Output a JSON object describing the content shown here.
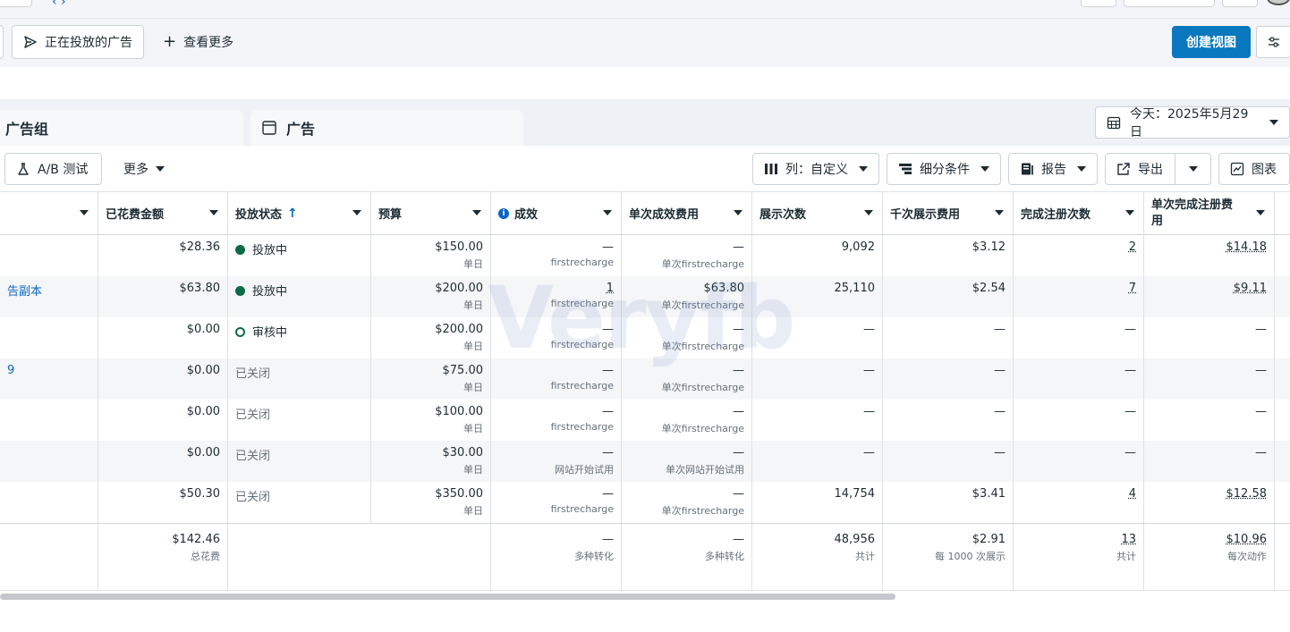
{
  "nav": {
    "running_ads_label": "正在投放的广告",
    "see_more_label": "查看更多",
    "create_view_label": "创建视图"
  },
  "tabs": {
    "adset_label": "广告组",
    "ad_label": "广告",
    "date_label": "今天：2025年5月29日"
  },
  "toolbar": {
    "ab_test_label": "A/B 测试",
    "more_label": "更多",
    "columns_label": "列：自定义",
    "breakdown_label": "细分条件",
    "report_label": "报告",
    "export_label": "导出",
    "chart_label": "图表"
  },
  "table": {
    "headers": [
      "已花费金额",
      "投放状态",
      "预算",
      "成效",
      "单次成效费用",
      "展示次数",
      "千次展示费用",
      "完成注册次数",
      "单次完成注册费用"
    ],
    "rows": [
      {
        "name": "",
        "spent": "$28.36",
        "status": "投放中",
        "budget": "$150.00",
        "budget_type": "单日",
        "result": "—",
        "result_sub": "firstrecharge",
        "cpr": "—",
        "cpr_sub": "单次firstrecharge",
        "impr": "9,092",
        "cpm": "$3.12",
        "reg": "2",
        "cpreg": "$14.18"
      },
      {
        "name": "告副本",
        "spent": "$63.80",
        "status": "投放中",
        "budget": "$200.00",
        "budget_type": "单日",
        "result": "1",
        "result_sub": "firstrecharge",
        "cpr": "$63.80",
        "cpr_sub": "单次firstrecharge",
        "impr": "25,110",
        "cpm": "$2.54",
        "reg": "7",
        "cpreg": "$9.11"
      },
      {
        "name": "",
        "spent": "$0.00",
        "status": "审核中",
        "budget": "$200.00",
        "budget_type": "单日",
        "result": "—",
        "result_sub": "firstrecharge",
        "cpr": "—",
        "cpr_sub": "单次firstrecharge",
        "impr": "—",
        "cpm": "—",
        "reg": "—",
        "cpreg": "—"
      },
      {
        "name": "9",
        "spent": "$0.00",
        "status": "已关闭",
        "budget": "$75.00",
        "budget_type": "单日",
        "result": "—",
        "result_sub": "firstrecharge",
        "cpr": "—",
        "cpr_sub": "单次firstrecharge",
        "impr": "—",
        "cpm": "—",
        "reg": "—",
        "cpreg": "—"
      },
      {
        "name": "",
        "spent": "$0.00",
        "status": "已关闭",
        "budget": "$100.00",
        "budget_type": "单日",
        "result": "—",
        "result_sub": "firstrecharge",
        "cpr": "—",
        "cpr_sub": "单次firstrecharge",
        "impr": "—",
        "cpm": "—",
        "reg": "—",
        "cpreg": "—"
      },
      {
        "name": "",
        "spent": "$0.00",
        "status": "已关闭",
        "budget": "$30.00",
        "budget_type": "单日",
        "result": "—",
        "result_sub": "网站开始试用",
        "cpr": "—",
        "cpr_sub": "单次网站开始试用",
        "impr": "—",
        "cpm": "—",
        "reg": "—",
        "cpreg": "—"
      },
      {
        "name": "",
        "spent": "$50.30",
        "status": "已关闭",
        "budget": "$350.00",
        "budget_type": "单日",
        "result": "—",
        "result_sub": "firstrecharge",
        "cpr": "—",
        "cpr_sub": "单次firstrecharge",
        "impr": "14,754",
        "cpm": "$3.41",
        "reg": "4",
        "cpreg": "$12.58"
      }
    ],
    "total": {
      "spent": "$142.46",
      "spent_sub": "总花费",
      "result": "—",
      "result_sub": "多种转化",
      "cpr": "—",
      "cpr_sub": "多种转化",
      "impr": "48,956",
      "impr_sub": "共计",
      "cpm": "$2.91",
      "cpm_sub": "每 1000 次展示",
      "reg": "13",
      "reg_sub": "共计",
      "cpreg": "$10.96",
      "cpreg_sub": "每次动作"
    }
  },
  "watermark": "Veryfb",
  "colors": {
    "primary": "#0a78be",
    "active_green": "#0c6b45",
    "link": "#0a66c2"
  }
}
